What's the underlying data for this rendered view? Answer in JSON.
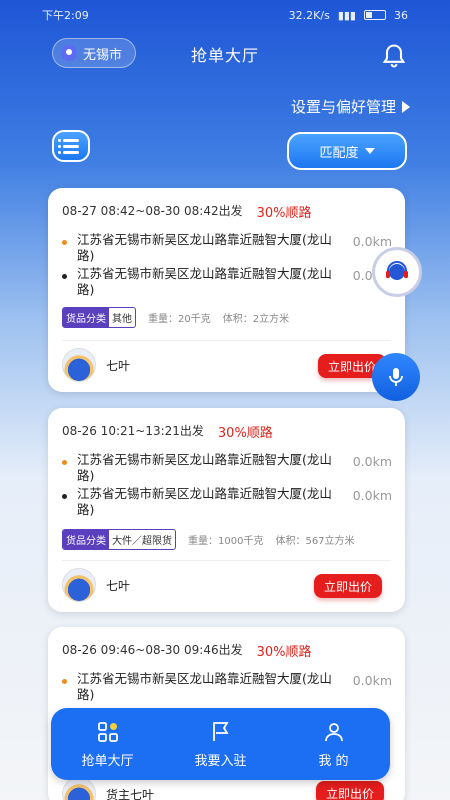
{
  "status": {
    "time": "下午2:09",
    "net": "32.2K/s",
    "battery": "36"
  },
  "header": {
    "city": "无锡市",
    "title": "抢单大厅",
    "prefs": "设置与偏好管理",
    "match": "匹配度"
  },
  "orders": [
    {
      "time": "08-27 08:42~08-30 08:42出发",
      "pct": "30%顺路",
      "from": "江苏省无锡市新吴区龙山路靠近融智大厦(龙山路)",
      "from_dist": "0.0km",
      "to": "江苏省无锡市新吴区龙山路靠近融智大厦(龙山路)",
      "to_dist": "0.0km",
      "tag_a": "货品分类",
      "tag_b": "其他",
      "weight": "重量：20千克",
      "volume": "体积：2立方米",
      "owner": "七叶",
      "btn": "立即出价"
    },
    {
      "time": "08-26 10:21~13:21出发",
      "pct": "30%顺路",
      "from": "江苏省无锡市新吴区龙山路靠近融智大厦(龙山路)",
      "from_dist": "0.0km",
      "to": "江苏省无锡市新吴区龙山路靠近融智大厦(龙山路)",
      "to_dist": "0.0km",
      "tag_a": "货品分类",
      "tag_b": "大件／超限货",
      "weight": "重量：1000千克",
      "volume": "体积：567立方米",
      "owner": "七叶",
      "btn": "立即出价"
    },
    {
      "time": "08-26 09:46~08-30 09:46出发",
      "pct": "30%顺路",
      "from": "江苏省无锡市新吴区龙山路靠近融智大厦(龙山路)",
      "from_dist": "0.0km",
      "owner": "货主七叶",
      "btn": "立即出价"
    }
  ],
  "tabs": [
    {
      "label": "抢单大厅",
      "icon": "grid-icon"
    },
    {
      "label": "我要入驻",
      "icon": "flag-icon"
    },
    {
      "label": "我 的",
      "icon": "person-icon"
    }
  ],
  "colors": {
    "primary": "#1c6ef2",
    "accent": "#e51d1d",
    "tag": "#5a3fbf"
  }
}
